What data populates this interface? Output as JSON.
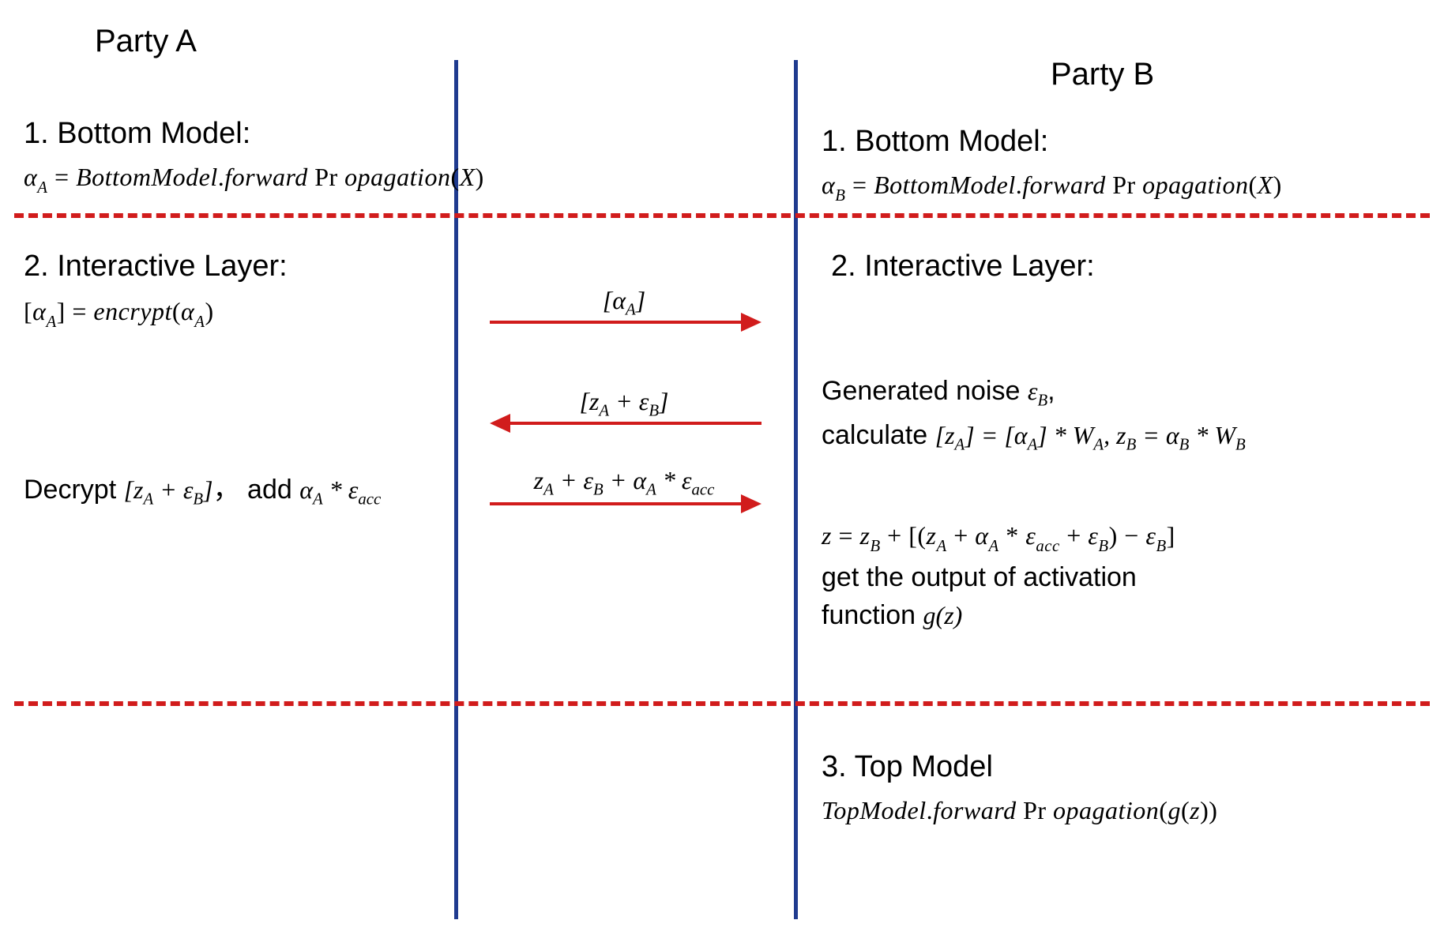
{
  "headers": {
    "partyA": "Party A",
    "partyB": "Party B"
  },
  "partyA": {
    "section1_title": "1. Bottom Model:",
    "section1_formula": "α_A = BottomModel.forwardPropagation(X)",
    "section2_title": "2. Interactive Layer:",
    "section2_encrypt": "[α_A] = encrypt(α_A)",
    "section2_decrypt_prefix": "Decrypt ",
    "section2_decrypt_expr": "[z_A + ε_B]",
    "section2_decrypt_mid": "， add ",
    "section2_decrypt_add": "α_A * ε_acc"
  },
  "partyB": {
    "section1_title": "1. Bottom Model:",
    "section1_formula": "α_B = BottomModel.forwardPropagation(X)",
    "section2_title": "2. Interactive Layer:",
    "section2_noise_prefix": "Generated noise ",
    "section2_noise_sym": "ε_B",
    "section2_noise_suffix": ",",
    "section2_calc_prefix": "calculate ",
    "section2_calc_expr": "[z_A] = [α_A] * W_A, z_B = α_B * W_B",
    "section2_z_expr": "z = z_B + [(z_A + α_A * ε_acc + ε_B) − ε_B]",
    "section2_output_line1": "get the output of activation",
    "section2_output_line2_prefix": "function ",
    "section2_output_gz": "g(z)",
    "section3_title": "3. Top Model",
    "section3_formula": "TopModel.forwardPropagation(g(z))"
  },
  "arrows": {
    "a1_label": "[α_A]",
    "a2_label": "[z_A + ε_B]",
    "a3_label": "z_A + ε_B + α_A * ε_acc"
  },
  "colors": {
    "blue": "#1f3b8f",
    "red": "#d11c1c"
  }
}
